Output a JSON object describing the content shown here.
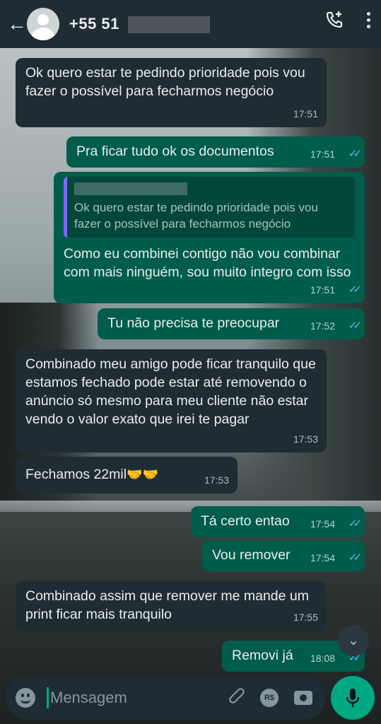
{
  "header": {
    "contact": "+55 51",
    "back_icon": "arrow-left-icon",
    "call_icon": "add-call-icon",
    "menu_icon": "more-vertical-icon"
  },
  "messages": [
    {
      "dir": "in",
      "text": "Ok quero estar te pedindo prioridade pois vou fazer o possível para fecharmos negócio",
      "time": "17:51"
    },
    {
      "dir": "out",
      "text": "Pra ficar tudo ok os documentos",
      "time": "17:51"
    },
    {
      "dir": "out",
      "quote": "Ok quero estar te pedindo prioridade pois vou fazer o possível para fecharmos negócio",
      "text": "Como eu combinei contigo não vou combinar com mais ninguém, sou muito integro com isso",
      "time": "17:51"
    },
    {
      "dir": "out",
      "text": "Tu não precisa te preocupar",
      "time": "17:52"
    },
    {
      "dir": "in",
      "text": "Combinado meu amigo pode ficar tranquilo que estamos fechado pode estar até removendo o anúncio só mesmo para meu cliente não estar vendo o valor exato que irei te pagar",
      "time": "17:53"
    },
    {
      "dir": "in",
      "text": "Fechamos 22mil",
      "emoji": "🤝🤝",
      "time": "17:53"
    },
    {
      "dir": "out",
      "text": "Tá certo entao",
      "time": "17:54"
    },
    {
      "dir": "out",
      "text": "Vou remover",
      "time": "17:54"
    },
    {
      "dir": "in",
      "text": "Combinado assim que remover me mande um print ficar mais tranquilo",
      "time": "17:55"
    },
    {
      "dir": "out",
      "text": "Removi já",
      "time": "18:08"
    }
  ],
  "composer": {
    "placeholder": "Mensagem",
    "currency_label": "R$",
    "emoji_icon": "emoji-icon",
    "attach_icon": "paperclip-icon",
    "camera_icon": "camera-icon",
    "mic_icon": "microphone-icon"
  },
  "colors": {
    "header": "#1f2c33",
    "incoming": "#202c33",
    "outgoing": "#005c4b",
    "read_ticks": "#53bdeb",
    "accent": "#00a884"
  }
}
